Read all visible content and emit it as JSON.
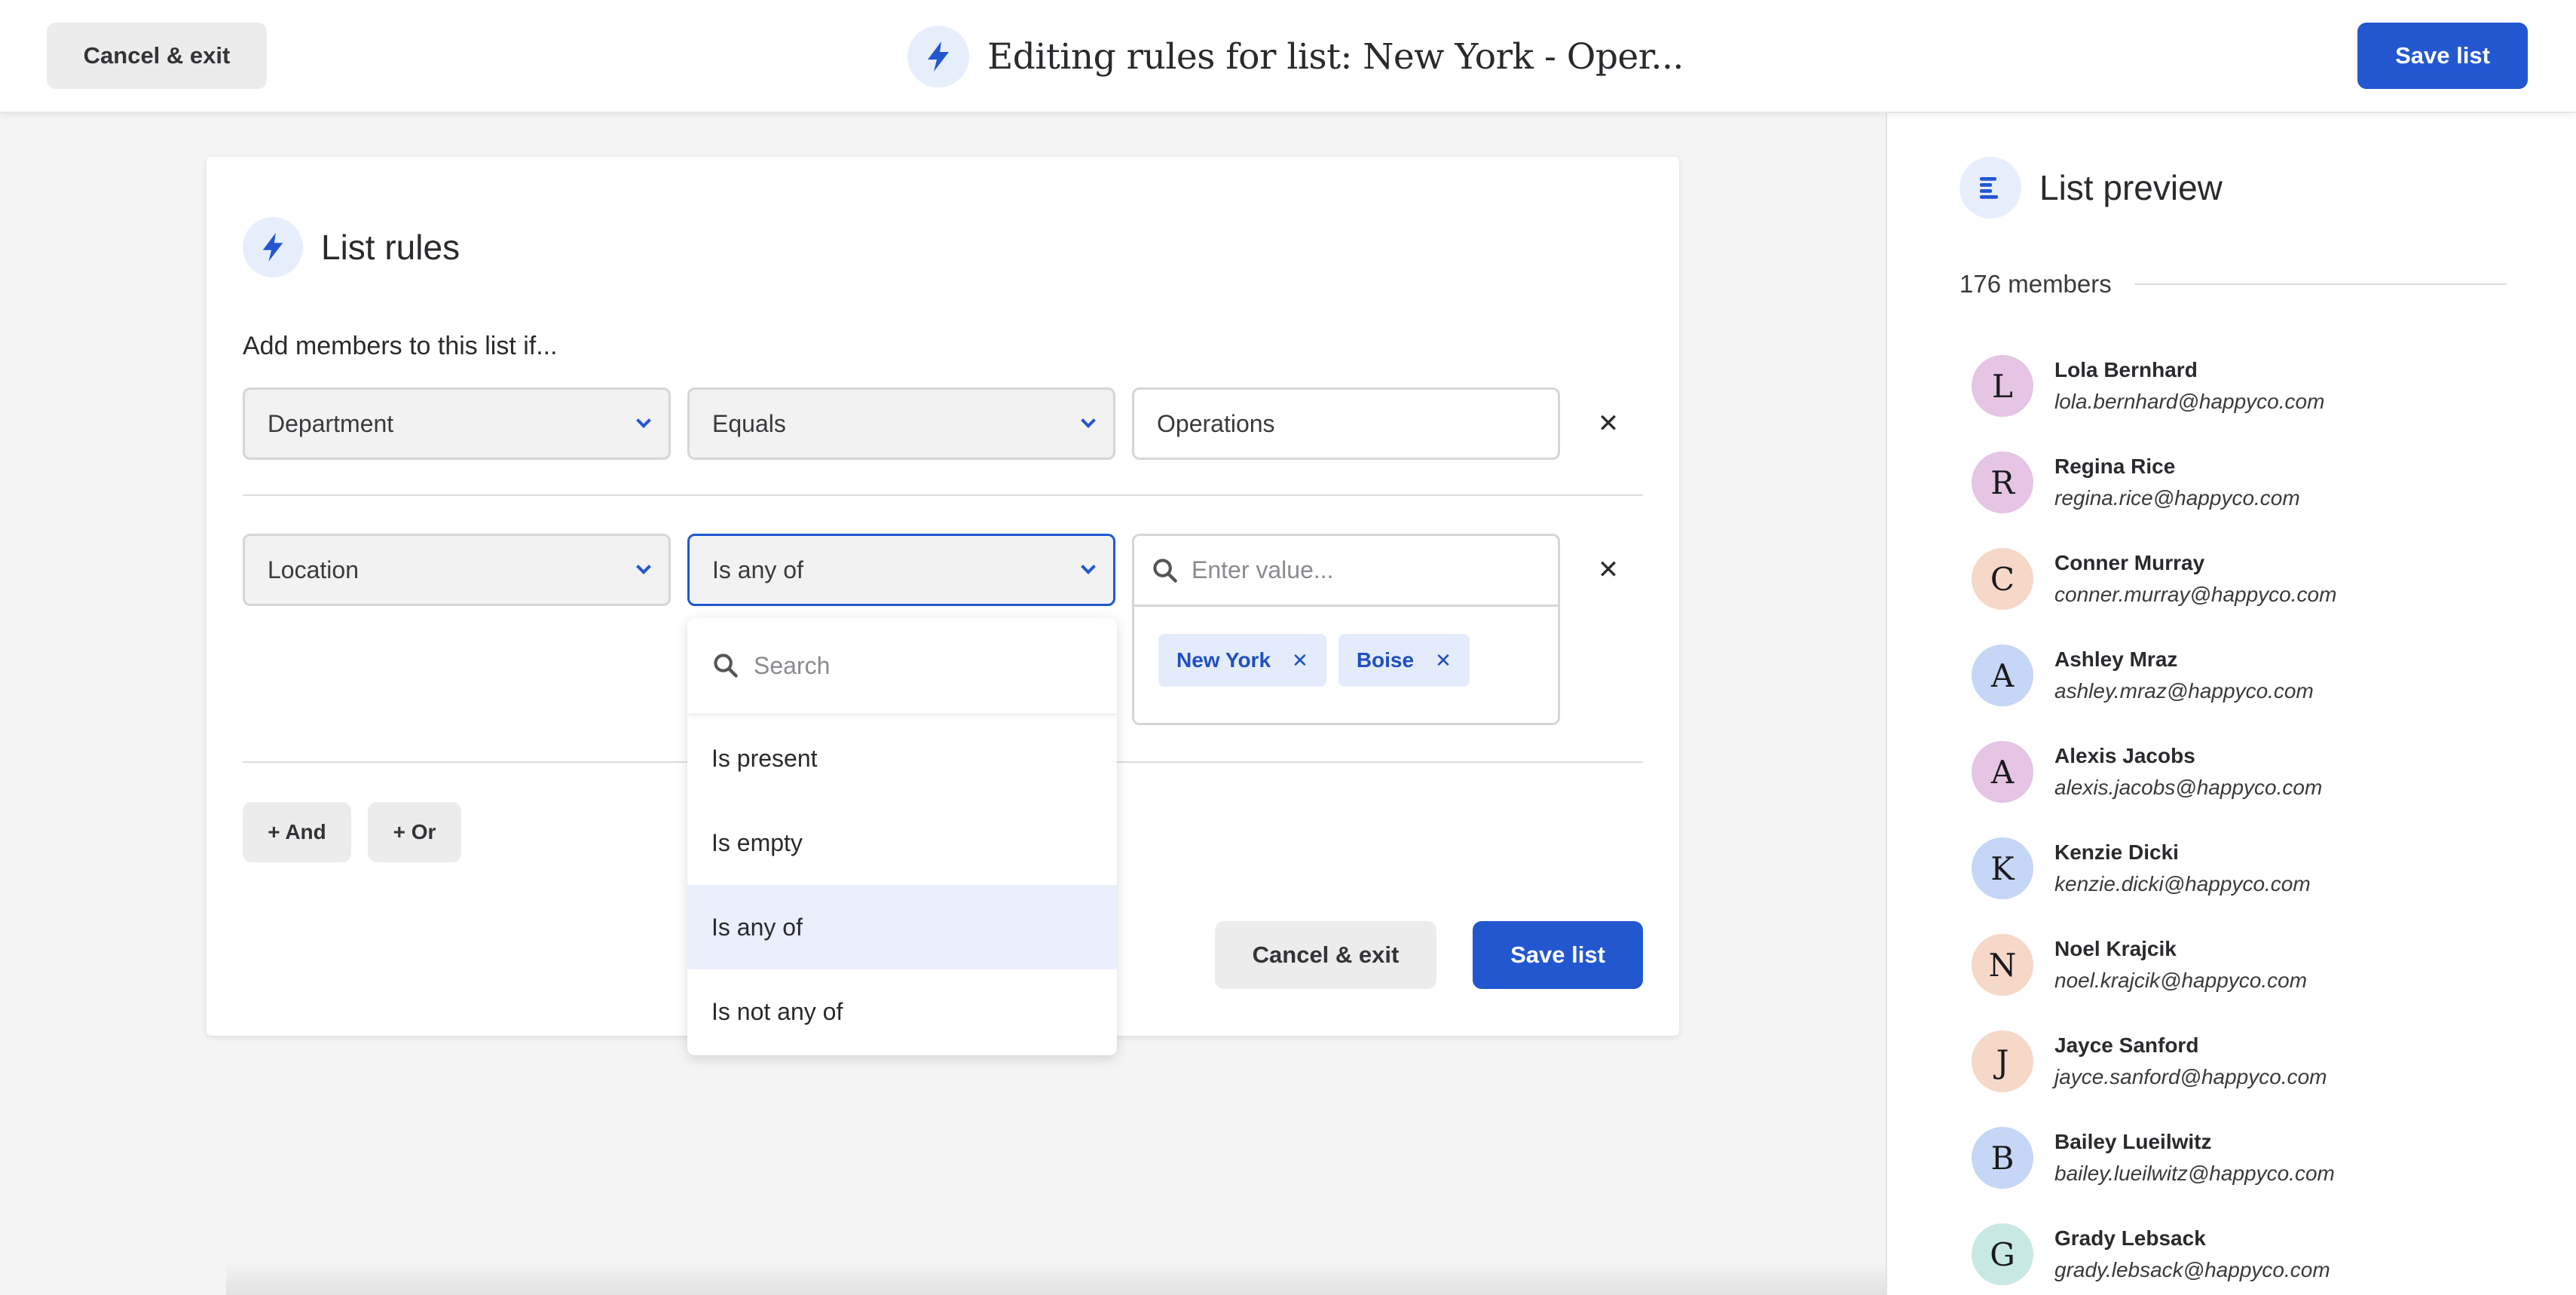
{
  "topbar": {
    "cancel_label": "Cancel & exit",
    "title": "Editing rules for list: New York - Oper...",
    "save_label": "Save list",
    "icon": "bolt-icon"
  },
  "rules": {
    "title": "List rules",
    "intro": "Add members to this list if...",
    "rule1": {
      "field": "Department",
      "operator": "Equals",
      "value": "Operations"
    },
    "rule2": {
      "field": "Location",
      "operator": "Is any of",
      "value_placeholder": "Enter value...",
      "chips": [
        "New York",
        "Boise"
      ]
    },
    "and_label": "+ And",
    "or_label": "+ Or",
    "cancel_label": "Cancel & exit",
    "save_label": "Save list"
  },
  "operator_dropdown": {
    "search_placeholder": "Search",
    "options": [
      "Is present",
      "Is empty",
      "Is any of",
      "Is not any of"
    ],
    "selected": "Is any of"
  },
  "preview": {
    "title": "List preview",
    "count_label": "176 members",
    "members": [
      {
        "initial": "L",
        "name": "Lola Bernhard",
        "email": "lola.bernhard@happyco.com",
        "color": "#e5c4e4"
      },
      {
        "initial": "R",
        "name": "Regina Rice",
        "email": "regina.rice@happyco.com",
        "color": "#e5c4e4"
      },
      {
        "initial": "C",
        "name": "Conner Murray",
        "email": "conner.murray@happyco.com",
        "color": "#f6d8c8"
      },
      {
        "initial": "A",
        "name": "Ashley Mraz",
        "email": "ashley.mraz@happyco.com",
        "color": "#c5d6f6"
      },
      {
        "initial": "A",
        "name": "Alexis Jacobs",
        "email": "alexis.jacobs@happyco.com",
        "color": "#e5c4e4"
      },
      {
        "initial": "K",
        "name": "Kenzie Dicki",
        "email": "kenzie.dicki@happyco.com",
        "color": "#c5d6f6"
      },
      {
        "initial": "N",
        "name": "Noel Krajcik",
        "email": "noel.krajcik@happyco.com",
        "color": "#f6d8c8"
      },
      {
        "initial": "J",
        "name": "Jayce Sanford",
        "email": "jayce.sanford@happyco.com",
        "color": "#f6d8c8"
      },
      {
        "initial": "B",
        "name": "Bailey Lueilwitz",
        "email": "bailey.lueilwitz@happyco.com",
        "color": "#c5d6f6"
      },
      {
        "initial": "G",
        "name": "Grady Lebsack",
        "email": "grady.lebsack@happyco.com",
        "color": "#c8e8e4"
      }
    ]
  },
  "colors": {
    "accent": "#2257d0",
    "chip_bg": "#e4ecfb",
    "selected_option_bg": "#e9effb"
  }
}
